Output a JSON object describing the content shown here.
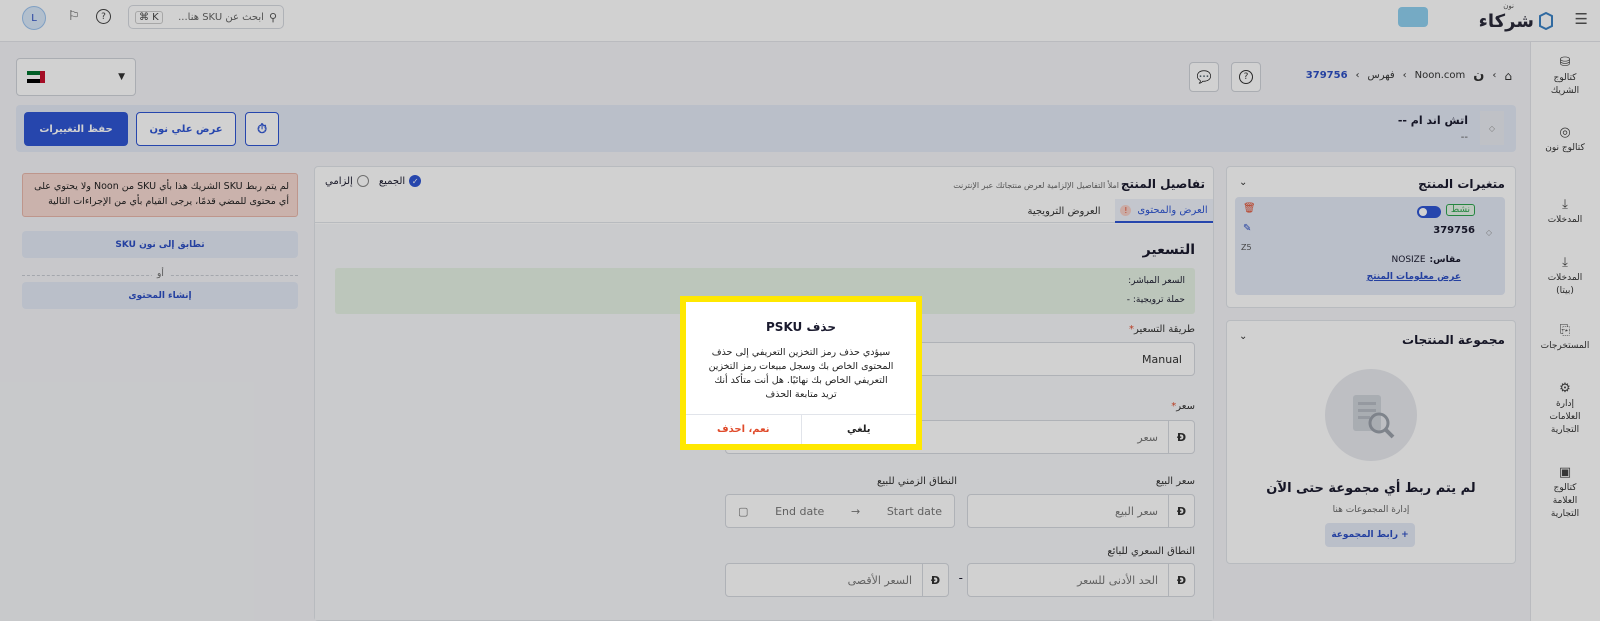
{
  "topbar": {
    "logo_main": "شركاء",
    "logo_sub": "نون",
    "avatar_letter": "L",
    "search_placeholder": "ابحث عن SKU هنا...",
    "search_shortcut": "⌘ K"
  },
  "sidebar": {
    "items": [
      {
        "label": "كتالوج الشريك"
      },
      {
        "label": "كتالوج نون"
      },
      {
        "label": "المدخلات"
      },
      {
        "label": "المدخلات (بيتا)"
      },
      {
        "label": "المستخرجات"
      },
      {
        "label": "إدارة العلامات التجارية"
      },
      {
        "label": "كتالوج العلامة التجارية"
      }
    ]
  },
  "breadcrumb": {
    "site": "Noon.com",
    "catalog": "فهرس",
    "id": "379756"
  },
  "product_header": {
    "title": "اتش اند ام --",
    "subtitle": "--"
  },
  "actions": {
    "save_label": "حفظ التغييرات",
    "view_label": "عرض علي نون"
  },
  "variants": {
    "title": "متغيرات المنتج",
    "status_badge": "نشط",
    "sku": "379756",
    "size_label": "مقاس:",
    "size_value": "NOSIZE",
    "view_link": "عرض معلومات المنتج",
    "side_code": "Z5"
  },
  "groups": {
    "title": "مجموعة المنتجات",
    "empty_title": "لم يتم ربط أي مجموعة حتى الآن",
    "manage_text": "إدارة المجموعات هنا",
    "link_button": "+ رابط المجموعة"
  },
  "details": {
    "title": "تفاصيل المنتج",
    "hint": "املأ التفاصيل الإلزامية لعرض منتجاتك عبر الإنترنت",
    "radio_mandatory": "إلزامي",
    "radio_all": "الجميع",
    "tab_offers_content": "العرض والمحتوى",
    "tab_promotions": "العروض الترويجية",
    "pricing_title": "التسعير",
    "live_price_label": "السعر المباشر:",
    "promo_label": "حملة ترويجية: -",
    "pricing_method_label": "طريقة التسعير",
    "pricing_method_value": "Manual",
    "price_label": "سعر",
    "price_placeholder": "سعر",
    "sale_price_label": "سعر البيع",
    "sale_price_placeholder": "سعر البيع",
    "sale_window_label": "النطاق الزمني للبيع",
    "start_date": "Start date",
    "end_date": "End date",
    "seller_range_label": "النطاق السعري للبائع",
    "min_price_placeholder": "الحد الأدنى للسعر",
    "max_price_placeholder": "السعر الأقصى",
    "currency_symbol": "Ð"
  },
  "notice": {
    "text": "لم يتم ربط SKU الشريك هذا بأي SKU من Noon ولا يحتوي على أي محتوى للمضي قدمًا، يرجى القيام بأي من الإجراءات التالية",
    "match_button": "تطابق إلى نون SKU",
    "or_text": "أو",
    "create_button": "إنشاء المحتوى"
  },
  "modal": {
    "title": "حذف PSKU",
    "body": "سيؤدي حذف رمز التخزين التعريفي إلى حذف المحتوى الخاص بك وسجل مبيعات رمز التخزين التعريفي الخاص بك نهائيًا. هل أنت متأكد أنك تريد متابعة الحذف",
    "cancel": "يلغي",
    "confirm": "نعم، احذف"
  },
  "colors": {
    "primary": "#2f56d3",
    "link": "#2c4fc4",
    "modal_border": "#ffe800",
    "danger": "#e04b2b",
    "badge_green": "#2ea44f"
  }
}
